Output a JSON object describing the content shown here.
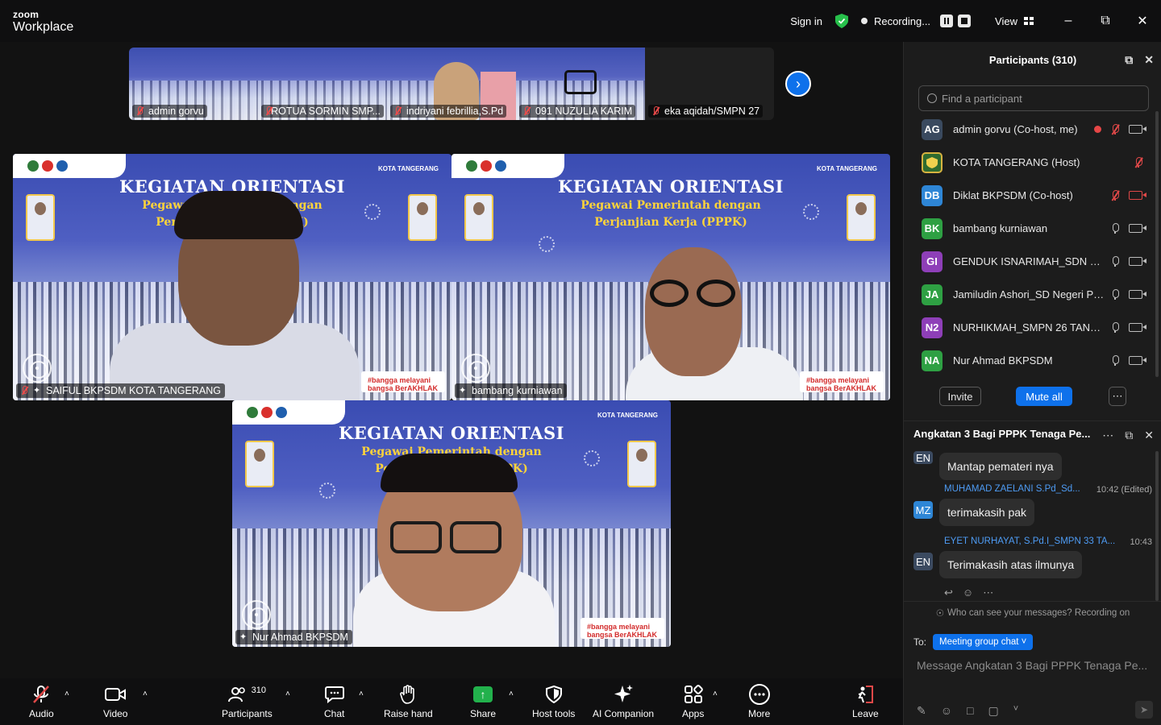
{
  "app": {
    "brand_top": "zoom",
    "brand_name": "Workplace"
  },
  "titlebar": {
    "sign_in": "Sign in",
    "recording_label": "Recording...",
    "view_label": "View",
    "minimize_icon": "minimize-icon",
    "restore_icon": "restore-icon",
    "close_icon": "close-icon"
  },
  "filmstrip": [
    {
      "name": "admin gorvu",
      "muted": true
    },
    {
      "name": "ROTUA SORMIN SMP...",
      "muted": true
    },
    {
      "name": "indriyani febrillia,S.Pd",
      "muted": true
    },
    {
      "name": "091 NUZULIA KARIM",
      "muted": true
    },
    {
      "name": "eka aqidah/SMPN 27",
      "muted": true
    }
  ],
  "slide": {
    "title": "KEGIATAN ORIENTASI",
    "subtitle_1": "Pegawai Pemerintah dengan",
    "subtitle_2": "Perjanjian Kerja (PPPK)",
    "city_badge": "KOTA TANGERANG",
    "footer_badge": "#bangga melayani bangsa BerAKHLAK"
  },
  "tiles": [
    {
      "name": "SAIFUL BKPSDM KOTA TANGERANG",
      "muted": true
    },
    {
      "name": "bambang kurniawan",
      "muted": false
    },
    {
      "name": "Nur Ahmad BKPSDM",
      "muted": false
    }
  ],
  "toolbar": {
    "audio": "Audio",
    "video": "Video",
    "participants": "Participants",
    "participants_count": "310",
    "chat": "Chat",
    "raise_hand": "Raise hand",
    "share": "Share",
    "host_tools": "Host tools",
    "ai_companion": "AI Companion",
    "apps": "Apps",
    "more": "More",
    "leave": "Leave"
  },
  "participants_panel": {
    "title": "Participants (310)",
    "search_placeholder": "Find a participant",
    "invite": "Invite",
    "mute_all": "Mute all",
    "list": [
      {
        "initials": "AG",
        "name": "admin gorvu (Co-host, me)",
        "color": "#3a4a5f",
        "mic": "off",
        "cam": "on",
        "recording": true
      },
      {
        "initials": "",
        "name": "KOTA TANGERANG (Host)",
        "color": "#2f6b2f",
        "mic": "off",
        "cam": "none",
        "recording": false
      },
      {
        "initials": "DB",
        "name": "Diklat BKPSDM (Co-host)",
        "color": "#2e86d6",
        "mic": "off",
        "cam": "off",
        "recording": false
      },
      {
        "initials": "BK",
        "name": "bambang kurniawan",
        "color": "#2ea043",
        "mic": "on",
        "cam": "on",
        "recording": false
      },
      {
        "initials": "GI",
        "name": "GENDUK  ISNARIMAH_SDN CIP...",
        "color": "#8e3fb8",
        "mic": "on",
        "cam": "on",
        "recording": false
      },
      {
        "initials": "JA",
        "name": "Jamiludin Ashori_SD Negeri Pa...",
        "color": "#2ea043",
        "mic": "on",
        "cam": "on",
        "recording": false
      },
      {
        "initials": "N2",
        "name": "NURHIKMAH_SMPN 26 TANGE...",
        "color": "#8e3fb8",
        "mic": "on",
        "cam": "on",
        "recording": false
      },
      {
        "initials": "NA",
        "name": "Nur Ahmad BKPSDM",
        "color": "#2ea043",
        "mic": "on",
        "cam": "on",
        "recording": false
      }
    ]
  },
  "chat_panel": {
    "title": "Angkatan 3 Bagi PPPK Tenaga Pe...",
    "messages": [
      {
        "initials": "EN",
        "sender": "",
        "time": "",
        "text": "Mantap pemateri nya"
      },
      {
        "initials": "MZ",
        "sender": "MUHAMAD ZAELANI S.Pd_Sd...",
        "time": "10:42 (Edited)",
        "text": "terimakasih pak"
      },
      {
        "initials": "EN",
        "sender": "EYET NURHAYAT, S.Pd.I_SMPN 33 TA...",
        "time": "10:43",
        "text": "Terimakasih atas ilmunya"
      }
    ],
    "visibility_note": "Who can see your messages? Recording on",
    "to_label": "To:",
    "to_target": "Meeting group chat",
    "input_placeholder": "Message Angkatan 3 Bagi PPPK Tenaga Pe..."
  }
}
